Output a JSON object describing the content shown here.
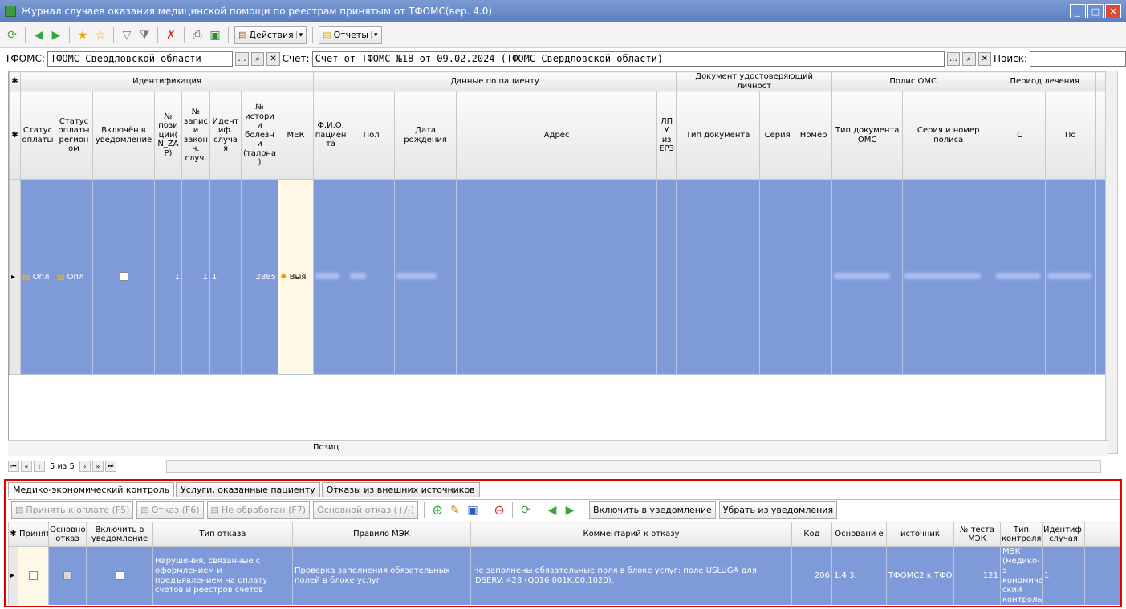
{
  "window": {
    "title": "Журнал случаев оказания медицинской помощи по реестрам принятым от ТФОМС(вер. 4.0)"
  },
  "toolbar": {
    "actions_label": "Действия",
    "reports_label": "Отчеты"
  },
  "filters": {
    "tfoms_label": "ТФОМС:",
    "tfoms_value": "ТФОМС Свердловской области",
    "account_label": "Счет:",
    "account_value": "Счет от ТФОМС №18 от 09.02.2024 (ТФОМС Свердловской области)",
    "search_label": "Поиск:",
    "search_value": ""
  },
  "main_grid": {
    "groups": {
      "identification": "Идентификация",
      "patient": "Данные по пациенту",
      "document": "Документ удостоверяющий личност",
      "policy": "Полис ОМС",
      "period": "Период лечения"
    },
    "columns": {
      "pay_status": "Статус оплаты",
      "pay_status_region": "Статус оплаты регион ом",
      "in_notice": "Включён в уведомление",
      "position": "№ пози ции( N_ZA P)",
      "record": "№ запис и закон ч. случ.",
      "case_id": "Идент иф. случа я",
      "history": "№ истори и болезн и (талона )",
      "mek": "МЕК",
      "fio": "Ф.И.О. пациен та",
      "sex": "Пол",
      "birth": "Дата рождения",
      "address": "Адрес",
      "lpu": "ЛП У из ЕРЗ",
      "doc_type": "Тип документа",
      "series": "Серия",
      "number": "Номер",
      "oms_type": "Тип документа ОМС",
      "policy_num": "Серия и номер полиса",
      "from": "С",
      "to": "По"
    },
    "row": {
      "pay_status": "Опл",
      "pay_status_region": "Опл",
      "position": "1",
      "record": "1",
      "case_id": "1",
      "history": "2885",
      "mek": "Выя"
    },
    "footer_label": "Позиц",
    "pager": "5 из 5"
  },
  "bottom_tabs": [
    "Медико-экономический контроль",
    "Услуги, оказанные пациенту",
    "Отказы из внешних источников"
  ],
  "bottom_toolbar": {
    "accept": "Принять к оплате (F5)",
    "refuse": "Отказ (F6)",
    "unprocessed": "Не обработан (F7)",
    "main_refusal": "Основной отказ (+/-)",
    "include": "Включить в уведомление",
    "remove": "Убрать из уведомления"
  },
  "mek_grid": {
    "columns": {
      "accepted": "Принят",
      "main_refusal": "Основной отказ",
      "include": "Включить в уведомление",
      "refusal_type": "Тип отказа",
      "rule": "Правило МЭК",
      "comment": "Комментарий к отказу",
      "code": "Код",
      "basis": "Основани е",
      "source": "источник",
      "test_no": "№ теста МЭК",
      "control_type": "Тип контроля",
      "case_id": "Идентиф. случая"
    },
    "row": {
      "refusal_type": "Нарушения, связанные с оформлением и предъявлением на оплату счетов и реестров счетов",
      "rule": "Проверка заполнения обязательных полей в блоке услуг",
      "comment": "Не заполнены обязательные поля в блоке услуг: поле USLUGA для IDSERV: 428 (Q016 001K.00.1020);",
      "code": "206",
      "basis": "1.4.3.",
      "source": "ТФОМС2 к ТФОМ",
      "test_no": "121",
      "control_type": "МЭК (медико-э кономиче ский контроль)",
      "case_id": "1"
    }
  },
  "colors": {
    "selection": "#7f9ad9",
    "highlight_border": "#e00000",
    "title_bar": "#6b8ed0"
  }
}
